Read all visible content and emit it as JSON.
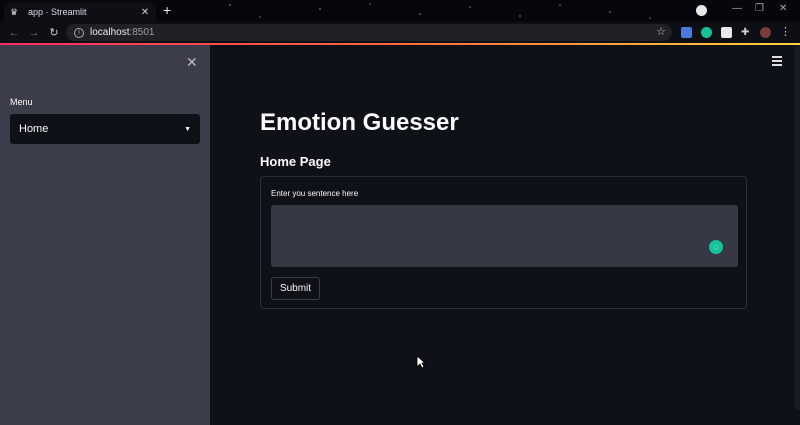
{
  "browser": {
    "tab_title": "app · Streamlit",
    "tab_close": "✕",
    "new_tab": "+",
    "url_host": "localhost",
    "url_port": ":8501"
  },
  "sidebar": {
    "close_glyph": "✕",
    "menu_label": "Menu",
    "select_value": "Home"
  },
  "main": {
    "title": "Emotion Guesser",
    "subtitle": "Home Page",
    "form": {
      "field_label": "Enter you sentence here",
      "textarea_value": "",
      "submit_label": "Submit"
    }
  },
  "colors": {
    "background": "#0e1117",
    "sidebar": "#3b3d4a",
    "text": "#fafafa",
    "accent_gradient": [
      "#ff2b62",
      "#ffd23b"
    ],
    "grammarly": "#15c39a"
  }
}
